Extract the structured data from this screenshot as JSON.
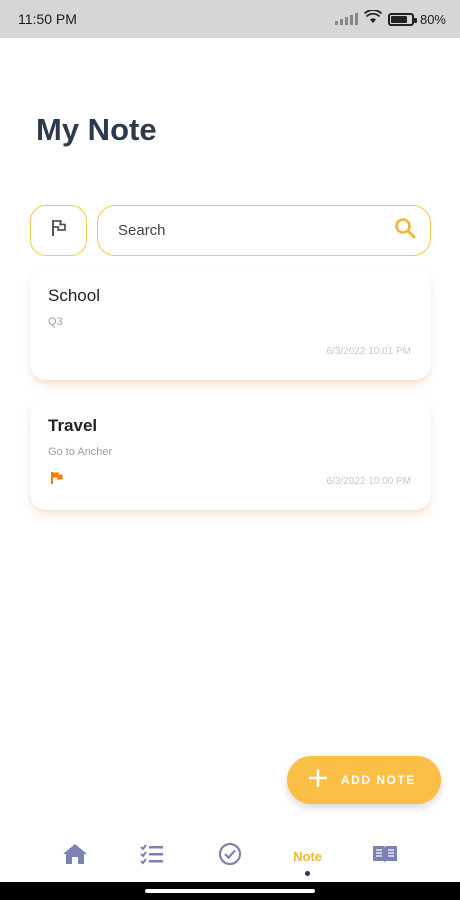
{
  "status": {
    "time": "11:50 PM",
    "battery_percent": "80%"
  },
  "page": {
    "title": "My Note"
  },
  "search": {
    "placeholder": "Search"
  },
  "notes": [
    {
      "title": "School",
      "subtitle": "Q3",
      "date": "6/3/2022 10:01 PM",
      "flagged": false
    },
    {
      "title": "Travel",
      "subtitle": "Go to Ancher",
      "date": "6/3/2022 10:00 PM",
      "flagged": true
    }
  ],
  "fab": {
    "label": "ADD NOTE"
  },
  "nav": {
    "items": [
      "home-icon",
      "checklist-icon",
      "check-circle-icon",
      "Note",
      "book-icon"
    ],
    "active_label": "Note"
  },
  "colors": {
    "accent": "#fbbf45",
    "border": "#f2c94c",
    "title": "#2c3a4b",
    "nav_icon": "#7e82b3",
    "flag": "#f57c00"
  }
}
